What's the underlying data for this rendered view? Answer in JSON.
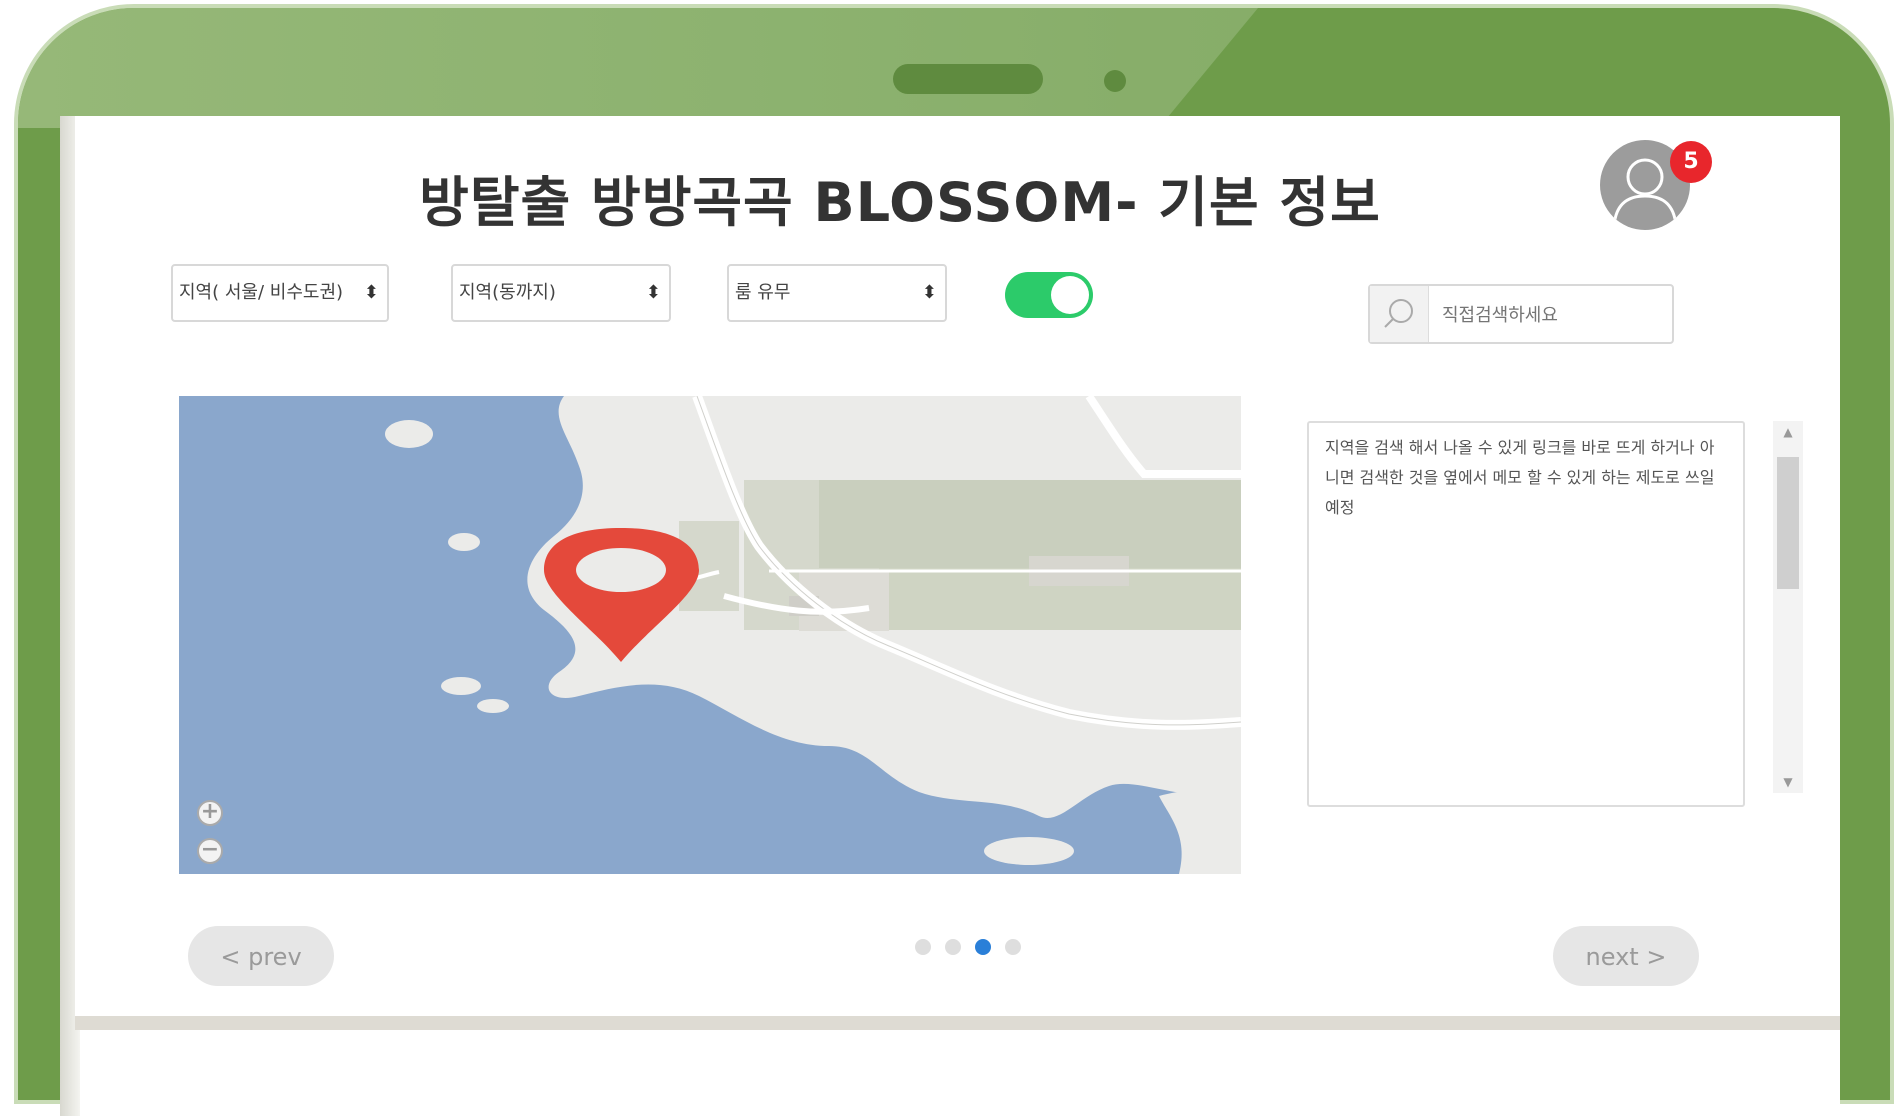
{
  "page": {
    "title": "방탈출 방방곡곡 BLOSSOM- 기본 정보"
  },
  "notifications": {
    "count": "5"
  },
  "filters": {
    "region": "지역( 서울/ 비수도권)",
    "area": "지역(동까지)",
    "availability": "룸 유무",
    "toggle_on": true
  },
  "search": {
    "placeholder": "직접검색하세요"
  },
  "memo": {
    "text": "지역을 검색 해서 나올 수 있게 링크를 바로 뜨게 하거나 아니면 검색한 것을 옆에서 메모 할 수 있게 하는 제도로 쓰일 예정"
  },
  "pagination": {
    "prev_label": "< prev",
    "next_label": "next >",
    "total_pages": 4,
    "active_index": 2
  },
  "icons": {
    "user": "user-avatar-icon",
    "search": "search-icon",
    "map_marker": "map-pin-icon",
    "zoom_in": "zoom-in-icon",
    "zoom_out": "zoom-out-icon"
  },
  "colors": {
    "frame": "#6e9c4a",
    "toggle": "#2ccb6a",
    "badge": "#e8262c",
    "marker": "#e4493b",
    "active_dot": "#2a7fd8",
    "water": "#8aa7cc"
  }
}
